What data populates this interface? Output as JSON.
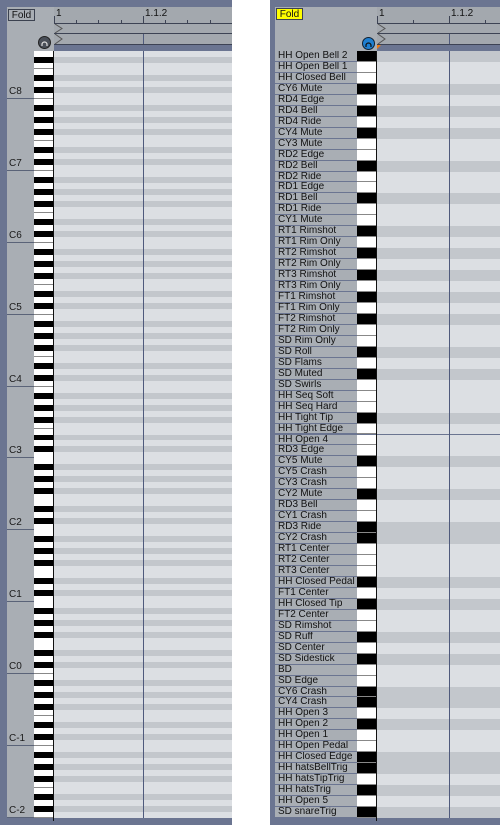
{
  "colors": {
    "frame": "#6b7591",
    "panel": "#a9aeb4",
    "grid_light": "#dcdfe3",
    "grid_dark": "#c3c7cc",
    "fold_active": "#ffff00",
    "headphones_active": "#1f7fd0"
  },
  "left_editor": {
    "fold_label": "Fold",
    "fold_active": false,
    "ruler_labels": [
      "1",
      "1.1.2"
    ],
    "headphones_icon": "headphones-icon",
    "octave_labels": [
      "C8",
      "C7",
      "C6",
      "C5",
      "C4",
      "C3",
      "C2",
      "C1",
      "C0",
      "C-1",
      "C-2"
    ]
  },
  "right_editor": {
    "fold_label": "Fold",
    "fold_active": true,
    "ruler_labels": [
      "1",
      "1.1.2"
    ],
    "headphones_icon": "headphones-icon",
    "rows": [
      {
        "name": "HH Open Bell 2",
        "key": "black"
      },
      {
        "name": "HH Open Bell 1",
        "key": "white"
      },
      {
        "name": "HH Closed Bell",
        "key": "white"
      },
      {
        "name": "CY6 Mute",
        "key": "black"
      },
      {
        "name": "RD4 Edge",
        "key": "white"
      },
      {
        "name": "RD4 Bell",
        "key": "black"
      },
      {
        "name": "RD4 Ride",
        "key": "white"
      },
      {
        "name": "CY4 Mute",
        "key": "black"
      },
      {
        "name": "CY3 Mute",
        "key": "white"
      },
      {
        "name": "RD2 Edge",
        "key": "white"
      },
      {
        "name": "RD2 Bell",
        "key": "black"
      },
      {
        "name": "RD2 Ride",
        "key": "white"
      },
      {
        "name": "RD1 Edge",
        "key": "white"
      },
      {
        "name": "RD1 Bell",
        "key": "black"
      },
      {
        "name": "RD1 Ride",
        "key": "white"
      },
      {
        "name": "CY1 Mute",
        "key": "white"
      },
      {
        "name": "RT1 Rimshot",
        "key": "black"
      },
      {
        "name": "RT1 Rim Only",
        "key": "white"
      },
      {
        "name": "RT2 Rimshot",
        "key": "black"
      },
      {
        "name": "RT2 Rim Only",
        "key": "white"
      },
      {
        "name": "RT3 Rimshot",
        "key": "black"
      },
      {
        "name": "RT3 Rim Only",
        "key": "white"
      },
      {
        "name": "FT1 Rimshot",
        "key": "black"
      },
      {
        "name": "FT1 Rim Only",
        "key": "white"
      },
      {
        "name": "FT2 Rimshot",
        "key": "black"
      },
      {
        "name": "FT2 Rim Only",
        "key": "white"
      },
      {
        "name": "SD Rim Only",
        "key": "white"
      },
      {
        "name": "SD Roll",
        "key": "black"
      },
      {
        "name": "SD Flams",
        "key": "white"
      },
      {
        "name": "SD Muted",
        "key": "black"
      },
      {
        "name": "SD Swirls",
        "key": "white"
      },
      {
        "name": "HH Seq Soft",
        "key": "white"
      },
      {
        "name": "HH Seq Hard",
        "key": "white"
      },
      {
        "name": "HH Tight Tip",
        "key": "black"
      },
      {
        "name": "HH Tight Edge",
        "key": "white"
      },
      {
        "name": "HH Open 4",
        "key": "white"
      },
      {
        "name": "RD3 Edge",
        "key": "white"
      },
      {
        "name": "CY5 Mute",
        "key": "black"
      },
      {
        "name": "CY5 Crash",
        "key": "white"
      },
      {
        "name": "CY3 Crash",
        "key": "white"
      },
      {
        "name": "CY2 Mute",
        "key": "black"
      },
      {
        "name": "RD3 Bell",
        "key": "white"
      },
      {
        "name": "CY1 Crash",
        "key": "white"
      },
      {
        "name": "RD3 Ride",
        "key": "black"
      },
      {
        "name": "CY2 Crash",
        "key": "black"
      },
      {
        "name": "RT1 Center",
        "key": "white"
      },
      {
        "name": "RT2 Center",
        "key": "white"
      },
      {
        "name": "RT3 Center",
        "key": "white"
      },
      {
        "name": "HH Closed Pedal",
        "key": "black"
      },
      {
        "name": "FT1 Center",
        "key": "white"
      },
      {
        "name": "HH Closed Tip",
        "key": "black"
      },
      {
        "name": "FT2 Center",
        "key": "white"
      },
      {
        "name": "SD Rimshot",
        "key": "white"
      },
      {
        "name": "SD Ruff",
        "key": "black"
      },
      {
        "name": "SD Center",
        "key": "white"
      },
      {
        "name": "SD Sidestick",
        "key": "black"
      },
      {
        "name": "BD",
        "key": "white"
      },
      {
        "name": "SD Edge",
        "key": "white"
      },
      {
        "name": "CY6 Crash",
        "key": "black"
      },
      {
        "name": "CY4 Crash",
        "key": "black"
      },
      {
        "name": "HH Open 3",
        "key": "white"
      },
      {
        "name": "HH Open 2",
        "key": "black"
      },
      {
        "name": "HH Open 1",
        "key": "white"
      },
      {
        "name": "HH Open Pedal",
        "key": "white"
      },
      {
        "name": "HH Closed Edge",
        "key": "black"
      },
      {
        "name": "HH hatsBellTrig",
        "key": "black"
      },
      {
        "name": "HH hatsTipTrig",
        "key": "white"
      },
      {
        "name": "HH hatsTrig",
        "key": "black"
      },
      {
        "name": "HH Open 5",
        "key": "white"
      },
      {
        "name": "SD snareTrig",
        "key": "black"
      }
    ]
  }
}
